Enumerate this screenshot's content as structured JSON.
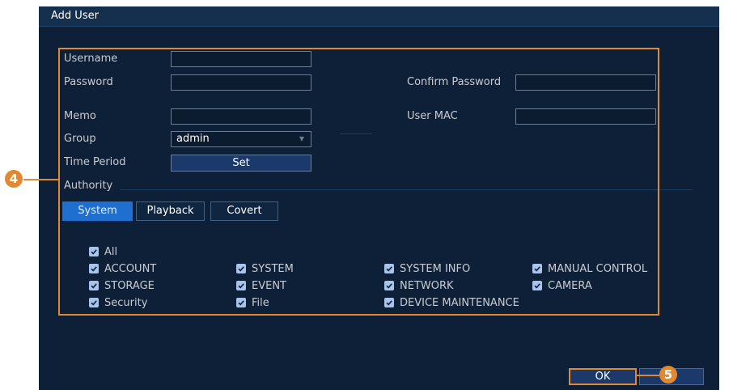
{
  "dialog": {
    "title": "Add User"
  },
  "form": {
    "username_label": "Username",
    "username_value": "",
    "password_label": "Password",
    "password_value": "",
    "confirm_password_label": "Confirm Password",
    "confirm_password_value": "",
    "memo_label": "Memo",
    "memo_value": "",
    "user_mac_label": "User MAC",
    "user_mac_value": "",
    "group_label": "Group",
    "group_value": "admin",
    "time_period_label": "Time Period",
    "set_button": "Set",
    "authority_label": "Authority"
  },
  "tabs": [
    {
      "label": "System",
      "active": true
    },
    {
      "label": "Playback",
      "active": false
    },
    {
      "label": "Covert",
      "active": false
    }
  ],
  "permissions": {
    "all": {
      "label": "All",
      "checked": true
    },
    "items": [
      {
        "label": "ACCOUNT",
        "checked": true
      },
      {
        "label": "SYSTEM",
        "checked": true
      },
      {
        "label": "SYSTEM INFO",
        "checked": true
      },
      {
        "label": "MANUAL CONTROL",
        "checked": true
      },
      {
        "label": "STORAGE",
        "checked": true
      },
      {
        "label": "EVENT",
        "checked": true
      },
      {
        "label": "NETWORK",
        "checked": true
      },
      {
        "label": "CAMERA",
        "checked": true
      },
      {
        "label": "Security",
        "checked": true
      },
      {
        "label": "File",
        "checked": true
      },
      {
        "label": "DEVICE MAINTENANCE",
        "checked": true
      }
    ]
  },
  "footer": {
    "ok_label": "OK",
    "cancel_label": ""
  },
  "callouts": {
    "step4": "4",
    "step5": "5"
  },
  "colors": {
    "background": "#0e2038",
    "titlebar": "#15304f",
    "highlight": "#e18832",
    "tab_active": "#1f6fd0",
    "checkbox": "#a9c4ea"
  }
}
